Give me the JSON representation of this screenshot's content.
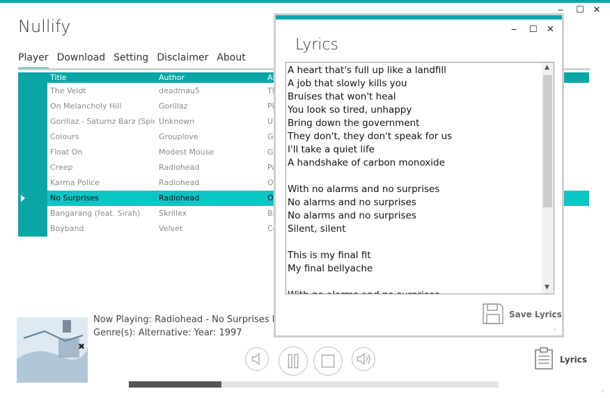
{
  "app": {
    "title": "Nullify",
    "window_controls": {
      "minimize": "‒",
      "maximize": "☐",
      "close": "✕"
    }
  },
  "tabs": [
    {
      "label": "Player",
      "active": true
    },
    {
      "label": "Download",
      "active": false
    },
    {
      "label": "Setting",
      "active": false
    },
    {
      "label": "Disclaimer",
      "active": false
    },
    {
      "label": "About",
      "active": false
    }
  ],
  "table": {
    "columns": [
      "Title",
      "Author",
      "Alb"
    ],
    "rows": [
      {
        "title": "The Veldt",
        "author": "deadmau5",
        "album": "The",
        "selected": false
      },
      {
        "title": "On Melancholy Hill",
        "author": "Gorillaz",
        "album": "Pla",
        "selected": false
      },
      {
        "title": "Gorillaz - Saturnz Barz (Spir...",
        "author": "Unknown",
        "album": "Un",
        "selected": false
      },
      {
        "title": "Colours",
        "author": "Grouplove",
        "album": "Gro",
        "selected": false
      },
      {
        "title": "Float On",
        "author": "Modest Mouse",
        "album": "Go",
        "selected": false
      },
      {
        "title": "Creep",
        "author": "Radiohead",
        "album": "Pab",
        "selected": false
      },
      {
        "title": "Karma Police",
        "author": "Radiohead",
        "album": "OK",
        "selected": false
      },
      {
        "title": "No Surprises",
        "author": "Radiohead",
        "album": "OK",
        "selected": true
      },
      {
        "title": "Bangarang (feat. Sirah)",
        "author": "Skrillex",
        "album": "Bar",
        "selected": false
      },
      {
        "title": "Boyband",
        "author": "Velvet",
        "album": "Cor",
        "selected": false
      }
    ]
  },
  "now_playing": {
    "line1": "Now Playing: Radiohead - No Surprises From",
    "line2": "Genre(s): Alternative: Year: 1997"
  },
  "controls": [
    "volume-down",
    "pause",
    "stop",
    "volume-up"
  ],
  "progress": {
    "fraction": 0.25
  },
  "lyrics_button": {
    "label": "Lyrics"
  },
  "lyrics_dialog": {
    "title": "Lyrics",
    "window_controls": {
      "minimize": "‒",
      "maximize": "☐",
      "close": "✕"
    },
    "text": "A heart that's full up like a landfill\nA job that slowly kills you\nBruises that won't heal\nYou look so tired, unhappy\nBring down the government\nThey don't, they don't speak for us\nI'll take a quiet life\nA handshake of carbon monoxide\n\nWith no alarms and no surprises\nNo alarms and no surprises\nNo alarms and no surprises\nSilent, silent\n\nThis is my final fit\nMy final bellyache\n\nWith no alarms and no surprises",
    "save_label": "Save Lyrics"
  },
  "colors": {
    "accent": "#0aa6a6",
    "selected_row": "#0cc4c4"
  }
}
